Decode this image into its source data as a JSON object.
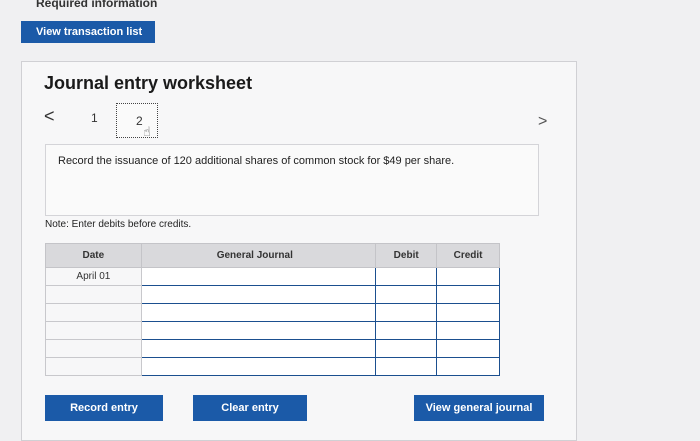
{
  "header": {
    "required_info": "Required information"
  },
  "buttons": {
    "view_transaction_list": "View transaction list",
    "record_entry": "Record entry",
    "clear_entry": "Clear entry",
    "view_general_journal": "View general journal"
  },
  "worksheet": {
    "title": "Journal entry worksheet",
    "pages": [
      "1",
      "2"
    ],
    "current_page": "2",
    "prev": "<",
    "next": ">",
    "instruction": "Record the issuance of 120 additional shares of common stock for $49 per share.",
    "note": "Note: Enter debits before credits."
  },
  "table": {
    "headers": [
      "Date",
      "General Journal",
      "Debit",
      "Credit"
    ],
    "rows": [
      {
        "date": "April 01",
        "account": "",
        "debit": "",
        "credit": ""
      },
      {
        "date": "",
        "account": "",
        "debit": "",
        "credit": ""
      },
      {
        "date": "",
        "account": "",
        "debit": "",
        "credit": ""
      },
      {
        "date": "",
        "account": "",
        "debit": "",
        "credit": ""
      },
      {
        "date": "",
        "account": "",
        "debit": "",
        "credit": ""
      },
      {
        "date": "",
        "account": "",
        "debit": "",
        "credit": ""
      }
    ]
  },
  "icons": {
    "cursor": "hand-pointer-icon"
  }
}
